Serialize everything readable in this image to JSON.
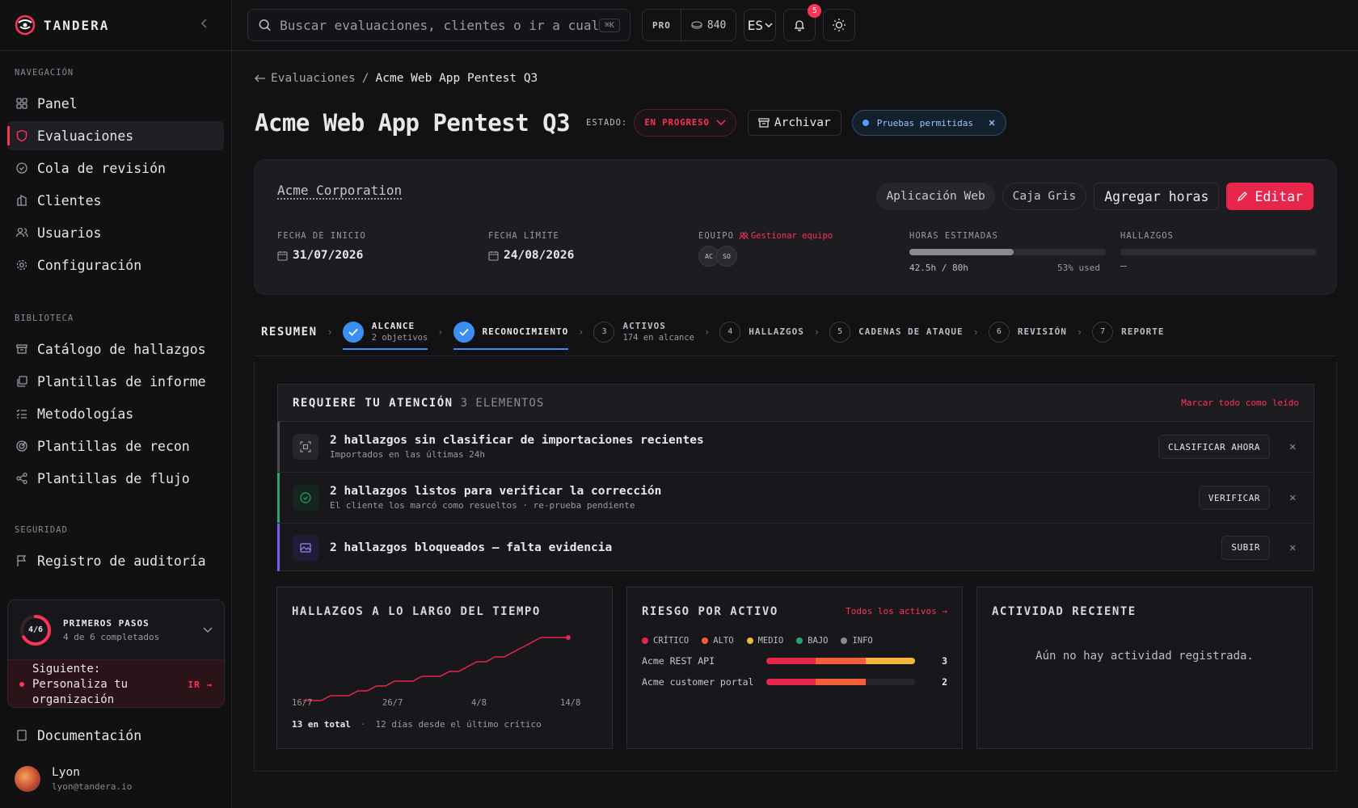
{
  "brand": {
    "name": "TANDERA"
  },
  "sidebar": {
    "nav_heading": "NAVEGACIÓN",
    "nav": [
      {
        "label": "Panel",
        "icon": "grid-icon"
      },
      {
        "label": "Evaluaciones",
        "icon": "shield-icon",
        "active": true
      },
      {
        "label": "Cola de revisión",
        "icon": "check-circle-icon"
      },
      {
        "label": "Clientes",
        "icon": "building-icon"
      },
      {
        "label": "Usuarios",
        "icon": "users-icon"
      },
      {
        "label": "Configuración",
        "icon": "gear-icon"
      }
    ],
    "library_heading": "BIBLIOTECA",
    "library": [
      {
        "label": "Catálogo de hallazgos",
        "icon": "archive-icon"
      },
      {
        "label": "Plantillas de informe",
        "icon": "copy-icon"
      },
      {
        "label": "Metodologías",
        "icon": "list-icon"
      },
      {
        "label": "Plantillas de recon",
        "icon": "target-icon"
      },
      {
        "label": "Plantillas de flujo",
        "icon": "share-icon"
      }
    ],
    "security_heading": "SEGURIDAD",
    "security": [
      {
        "label": "Registro de auditoría",
        "icon": "flag-icon"
      }
    ],
    "onboarding": {
      "progress_label": "4/6",
      "progress": 0.6667,
      "title": "PRIMEROS PASOS",
      "subtitle": "4 de 6 completados",
      "next": "Siguiente: Personaliza tu organización",
      "go": "IR →"
    },
    "docs": {
      "label": "Documentación"
    },
    "user": {
      "name": "Lyon",
      "email": "lyon@tandera.io"
    }
  },
  "topbar": {
    "search_placeholder": "Buscar evaluaciones, clientes o ir a cualq…",
    "search_kbd": "⌘K",
    "plan": "PRO",
    "credits": "840",
    "lang": "ES",
    "notifications": "5"
  },
  "breadcrumb": {
    "parent": "Evaluaciones",
    "separator": "/",
    "current": "Acme Web App Pentest Q3"
  },
  "assessment": {
    "title": "Acme Web App Pentest Q3",
    "estado_label": "ESTADO:",
    "status": "EN PROGRESO",
    "archive": "Archivar",
    "testing_pill": "Pruebas permitidas",
    "client": "Acme Corporation",
    "tags": [
      "Aplicación Web",
      "Caja Gris"
    ],
    "add_hours": "Agregar horas",
    "edit": "Editar",
    "start_label": "FECHA DE INICIO",
    "start": "31/07/2026",
    "due_label": "FECHA LÍMITE",
    "due": "24/08/2026",
    "team_label": "EQUIPO",
    "team_manage": "Gestionar equipo",
    "team": [
      "AC",
      "SO"
    ],
    "hours_label": "HORAS ESTIMADAS",
    "hours": "42.5h / 80h",
    "hours_used": "53% used",
    "hours_fraction": 0.53,
    "findings_label": "HALLAZGOS",
    "findings": "—"
  },
  "stepper": {
    "summary": "RESUMEN",
    "steps": [
      {
        "num": "",
        "label": "ALCANCE",
        "sub": "2 objetivos",
        "done": true
      },
      {
        "num": "",
        "label": "RECONOCIMIENTO",
        "sub": "",
        "done": true
      },
      {
        "num": "3",
        "label": "ACTIVOS",
        "sub": "174 en alcance",
        "done": false
      },
      {
        "num": "4",
        "label": "HALLAZGOS",
        "sub": "",
        "done": false
      },
      {
        "num": "5",
        "label": "CADENAS DE ATAQUE",
        "sub": "",
        "done": false
      },
      {
        "num": "6",
        "label": "REVISIÓN",
        "sub": "",
        "done": false
      },
      {
        "num": "7",
        "label": "REPORTE",
        "sub": "",
        "done": false
      }
    ]
  },
  "attention": {
    "title": "REQUIERE TU ATENCIÓN",
    "count": "3 ELEMENTOS",
    "mark_all": "Marcar todo como leído",
    "items": [
      {
        "title": "2 hallazgos sin clasificar de importaciones recientes",
        "sub": "Importados en las últimas 24h",
        "action": "CLASIFICAR AHORA"
      },
      {
        "title": "2 hallazgos listos para verificar la corrección",
        "sub": "El cliente los marcó como resueltos · re-prueba pendiente",
        "action": "VERIFICAR"
      },
      {
        "title": "2 hallazgos bloqueados — falta evidencia",
        "sub": "",
        "action": "SUBIR"
      }
    ]
  },
  "findings_over_time": {
    "title": "HALLAZGOS A LO LARGO DEL TIEMPO",
    "total": "13 en total",
    "since": "12 días desde el último crítico",
    "sep": "·"
  },
  "chart_data": {
    "type": "line",
    "title": "HALLAZGOS A LO LARGO DEL TIEMPO",
    "x_ticks": [
      "16/7",
      "26/7",
      "4/8",
      "14/8"
    ],
    "x": [
      0,
      1,
      2,
      3,
      4,
      5,
      6,
      7,
      8,
      9,
      10,
      11,
      12,
      13,
      14,
      15,
      16,
      17,
      18,
      19,
      20,
      21,
      22,
      23,
      24,
      25,
      26,
      27,
      28,
      29
    ],
    "values": [
      0,
      0,
      0,
      1,
      1,
      1,
      2,
      2,
      3,
      3,
      4,
      4,
      4,
      5,
      5,
      5,
      6,
      6,
      7,
      8,
      8,
      9,
      9,
      10,
      11,
      12,
      13,
      13,
      13,
      13
    ],
    "ylim": [
      0,
      13
    ],
    "color": "#e8254b"
  },
  "risk": {
    "title": "RIESGO POR ACTIVO",
    "link": "Todos los activos →",
    "legend": [
      {
        "label": "CRÍTICO",
        "color": "#e8254b"
      },
      {
        "label": "ALTO",
        "color": "#f2603a"
      },
      {
        "label": "MEDIO",
        "color": "#f2b63a"
      },
      {
        "label": "BAJO",
        "color": "#21a870"
      },
      {
        "label": "INFO",
        "color": "#8a8a90"
      }
    ],
    "assets": [
      {
        "name": "Acme REST API",
        "count": "3",
        "segments": [
          1,
          1,
          1,
          0,
          0
        ]
      },
      {
        "name": "Acme customer portal",
        "count": "2",
        "segments": [
          1,
          1,
          0,
          0,
          0
        ]
      }
    ]
  },
  "activity": {
    "title": "ACTIVIDAD RECIENTE",
    "empty": "Aún no hay actividad registrada."
  }
}
